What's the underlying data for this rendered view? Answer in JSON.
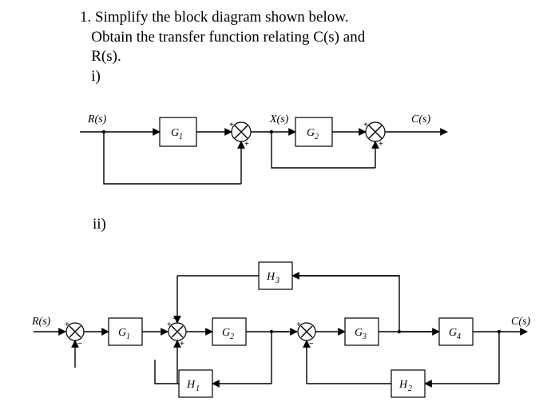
{
  "problem": {
    "number": "1.",
    "line1": "Simplify the block diagram shown below.",
    "line2": "Obtain the transfer function relating C(s) and",
    "line3": "R(s).",
    "part_i": "i)",
    "part_ii": "ii)"
  },
  "diag1": {
    "R": "R(s)",
    "X": "X(s)",
    "C": "C(s)",
    "G1": "G",
    "G1sub": "1",
    "G2": "G",
    "G2sub": "2",
    "s1_plus_top": "+",
    "s1_plus_bot": "+",
    "s2_plus": "+",
    "s2_plus2": "+"
  },
  "diag2": {
    "R": "R(s)",
    "C": "C(s)",
    "G1": "G",
    "G1sub": "1",
    "G2": "G",
    "G2sub": "2",
    "G3": "G",
    "G3sub": "3",
    "G4": "G",
    "G4sub": "4",
    "H1": "H",
    "H1sub": "1",
    "H2": "H",
    "H2sub": "2",
    "H3": "H",
    "H3sub": "3",
    "p": "+",
    "m": "−"
  }
}
